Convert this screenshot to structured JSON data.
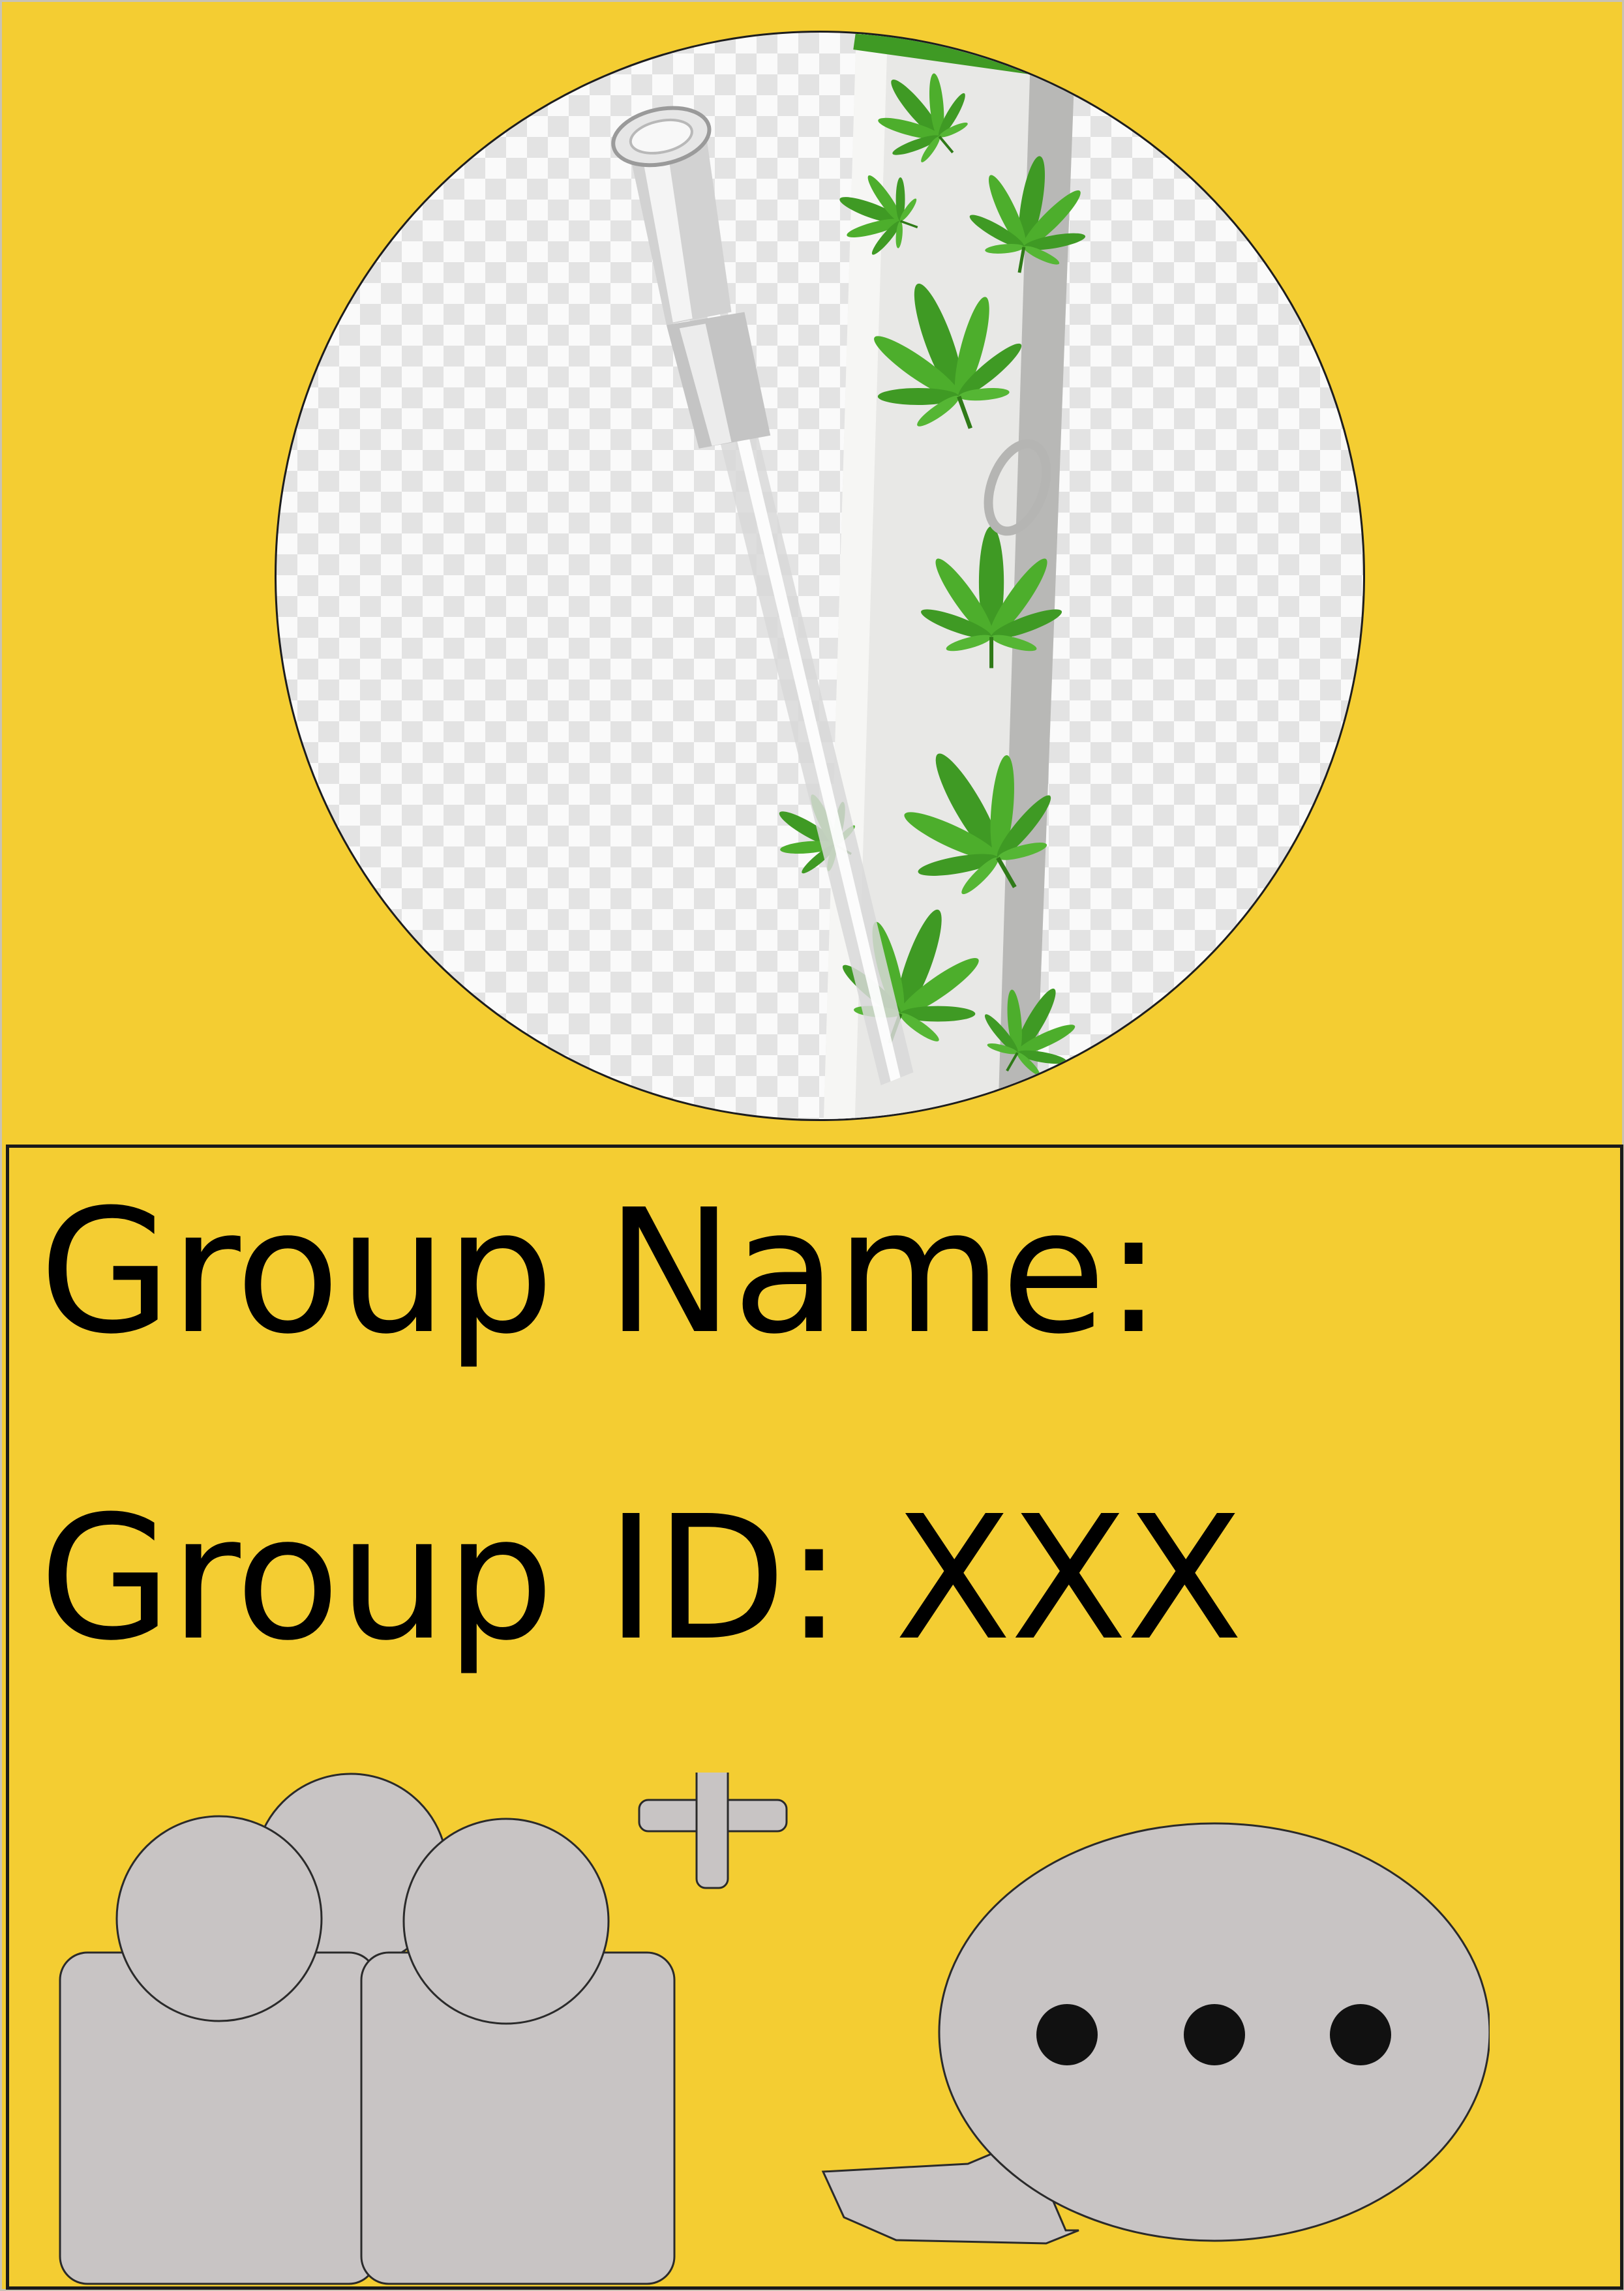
{
  "card": {
    "background_color": "#f4cd32",
    "photo": {
      "icon": "cannabis-bong-image"
    },
    "group_name_label": "Group Name:",
    "group_id_label": "Group ID: XXX"
  },
  "actions": {
    "add_member": {
      "icon": "add-group-icon",
      "color": "#c8c4c4"
    },
    "chat": {
      "icon": "chat-bubble-icon",
      "color": "#c8c4c4"
    }
  }
}
